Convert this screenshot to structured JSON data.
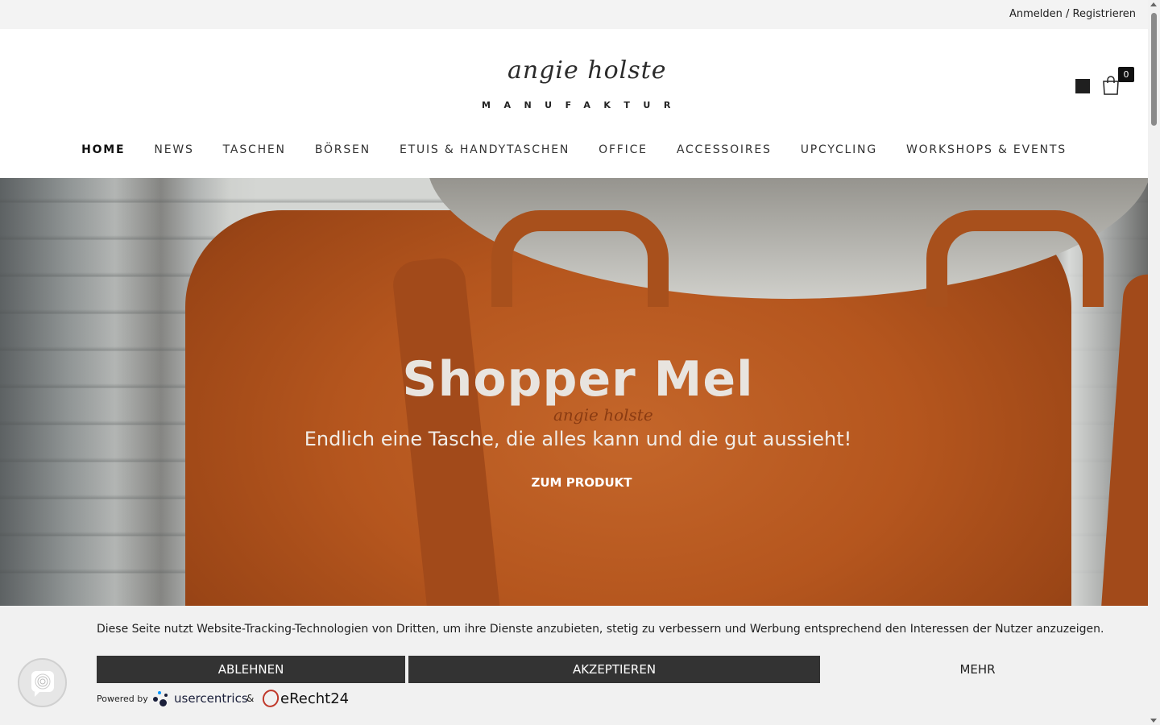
{
  "topbar": {
    "account_link": "Anmelden / Registrieren"
  },
  "header": {
    "logo_script": "angie holste",
    "logo_sub": "MANUFAKTUR",
    "cart_count": "0"
  },
  "nav": {
    "items": [
      {
        "label": "HOME"
      },
      {
        "label": "NEWS"
      },
      {
        "label": "TASCHEN"
      },
      {
        "label": "BÖRSEN"
      },
      {
        "label": "ETUIS & HANDYTASCHEN"
      },
      {
        "label": "OFFICE"
      },
      {
        "label": "ACCESSOIRES"
      },
      {
        "label": "UPCYCLING"
      },
      {
        "label": "WORKSHOPS & EVENTS"
      }
    ]
  },
  "hero": {
    "title": "Shopper Mel",
    "subtitle": "Endlich eine Tasche, die alles kann und die gut aussieht!",
    "cta": "ZUM PRODUKT",
    "bag_logo": "angie holste"
  },
  "cookie": {
    "text": "Diese Seite nutzt Website-Tracking-Technologien von Dritten, um ihre Dienste anzubieten, stetig zu verbessern und Werbung entsprechend den Interessen der Nutzer anzuzeigen.",
    "deny_label": "ABLEHNEN",
    "accept_label": "AKZEPTIEREN",
    "more_label": "MEHR",
    "powered_by": "Powered by",
    "usercentrics": "usercentrics",
    "amp": "&",
    "erecht": "eRecht24"
  },
  "colors": {
    "nav_active": "#111111",
    "button_dark": "#333333",
    "banner_bg": "#f1f1f1",
    "leather": "#b5561e"
  },
  "icons": [
    "square-icon",
    "cart-icon",
    "fingerprint-icon",
    "usercentrics-logo-icon",
    "erecht24-logo-icon"
  ]
}
